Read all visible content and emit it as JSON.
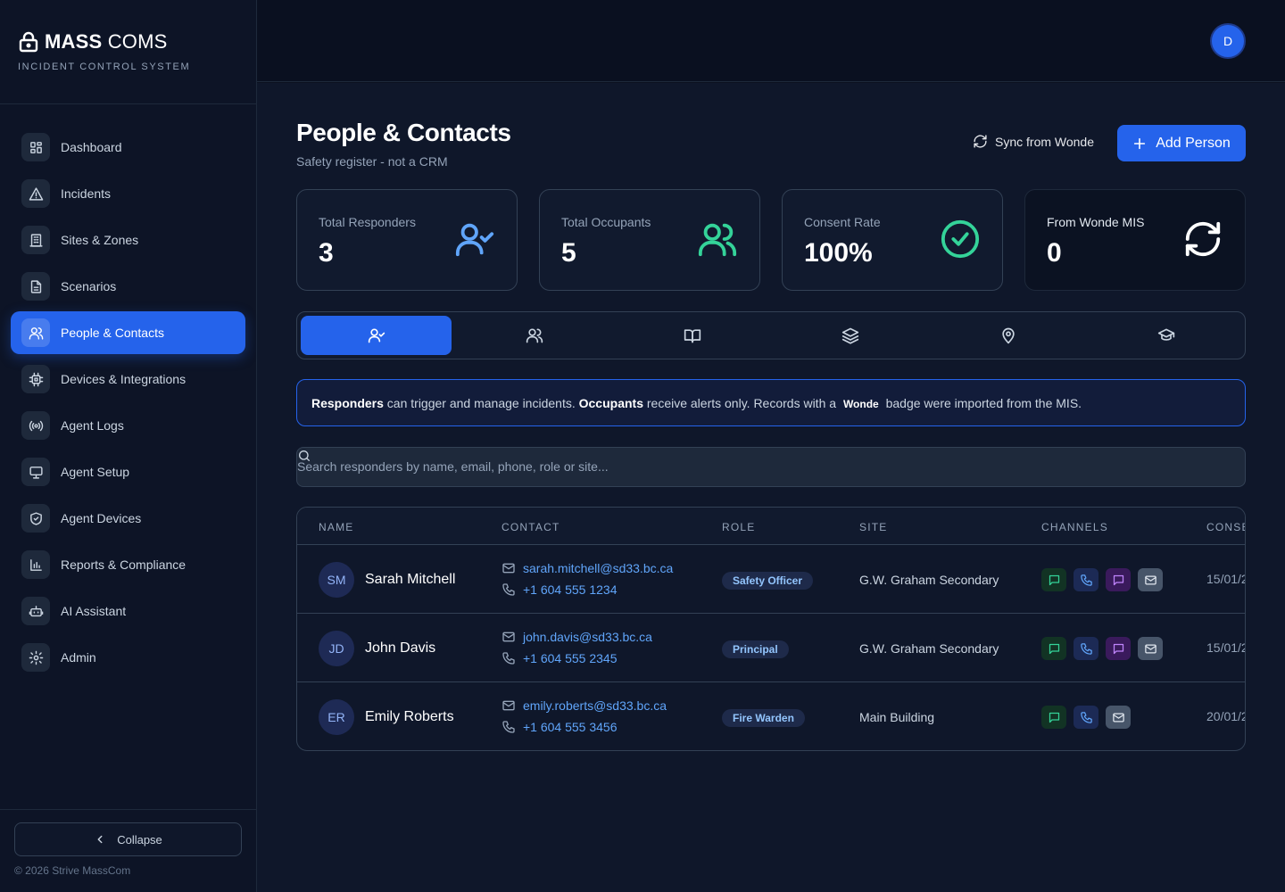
{
  "brand": {
    "name_bold": "MASS",
    "name_light": "COMS",
    "subtitle": "INCIDENT CONTROL SYSTEM"
  },
  "nav": [
    {
      "label": "Dashboard",
      "icon": "dashboard-icon"
    },
    {
      "label": "Incidents",
      "icon": "warning-icon"
    },
    {
      "label": "Sites & Zones",
      "icon": "building-icon"
    },
    {
      "label": "Scenarios",
      "icon": "document-icon"
    },
    {
      "label": "People & Contacts",
      "icon": "users-icon",
      "active": true
    },
    {
      "label": "Devices & Integrations",
      "icon": "chip-icon"
    },
    {
      "label": "Agent Logs",
      "icon": "broadcast-icon"
    },
    {
      "label": "Agent Setup",
      "icon": "monitor-icon"
    },
    {
      "label": "Agent Devices",
      "icon": "shield-icon"
    },
    {
      "label": "Reports & Compliance",
      "icon": "bar-chart-icon"
    },
    {
      "label": "AI Assistant",
      "icon": "bot-icon"
    },
    {
      "label": "Admin",
      "icon": "gear-icon"
    }
  ],
  "sidebar_footer": {
    "collapse": "Collapse",
    "copyright": "© 2026 Strive MassCom"
  },
  "topbar": {
    "avatar_initial": "D"
  },
  "page": {
    "title": "People & Contacts",
    "subtitle": "Safety register - not a CRM",
    "sync_label": "Sync from Wonde",
    "add_label": "Add Person"
  },
  "stats": [
    {
      "label": "Total Responders",
      "value": "3",
      "icon": "user-check-icon",
      "color": "#60a5fa"
    },
    {
      "label": "Total Occupants",
      "value": "5",
      "icon": "users-icon",
      "color": "#34d399"
    },
    {
      "label": "Consent Rate",
      "value": "100%",
      "icon": "check-circle-icon",
      "color": "#34d399"
    },
    {
      "label": "From Wonde MIS",
      "value": "0",
      "icon": "refresh-icon",
      "color": "#ffffff"
    }
  ],
  "tabs": [
    {
      "icon": "user-check-icon",
      "active": true
    },
    {
      "icon": "users-icon"
    },
    {
      "icon": "book-icon"
    },
    {
      "icon": "layers-icon"
    },
    {
      "icon": "map-pin-icon"
    },
    {
      "icon": "graduation-cap-icon"
    }
  ],
  "info": {
    "responders": "Responders",
    "text1": " can trigger and manage incidents. ",
    "occupants": "Occupants",
    "text2": " receive alerts only. Records with a ",
    "wonde": "Wonde",
    "text3": " badge were imported from the MIS."
  },
  "search": {
    "placeholder": "Search responders by name, email, phone, role or site..."
  },
  "table": {
    "headers": [
      "NAME",
      "CONTACT",
      "ROLE",
      "SITE",
      "CHANNELS",
      "CONSE"
    ],
    "rows": [
      {
        "initials": "SM",
        "name": "Sarah Mitchell",
        "email": "sarah.mitchell@sd33.bc.ca",
        "phone": "+1 604 555 1234",
        "role": "Safety Officer",
        "site": "G.W. Graham Secondary",
        "channels": [
          "sms",
          "call",
          "chat",
          "mail"
        ],
        "consent": "15/01/2"
      },
      {
        "initials": "JD",
        "name": "John Davis",
        "email": "john.davis@sd33.bc.ca",
        "phone": "+1 604 555 2345",
        "role": "Principal",
        "site": "G.W. Graham Secondary",
        "channels": [
          "sms",
          "call",
          "chat",
          "mail"
        ],
        "consent": "15/01/2"
      },
      {
        "initials": "ER",
        "name": "Emily Roberts",
        "email": "emily.roberts@sd33.bc.ca",
        "phone": "+1 604 555 3456",
        "role": "Fire Warden",
        "site": "Main Building",
        "channels": [
          "sms",
          "call",
          "mail"
        ],
        "consent": "20/01/2"
      }
    ]
  },
  "colors": {
    "accent": "#2563eb",
    "background": "#0f172a",
    "sidebar": "#0d1426"
  }
}
